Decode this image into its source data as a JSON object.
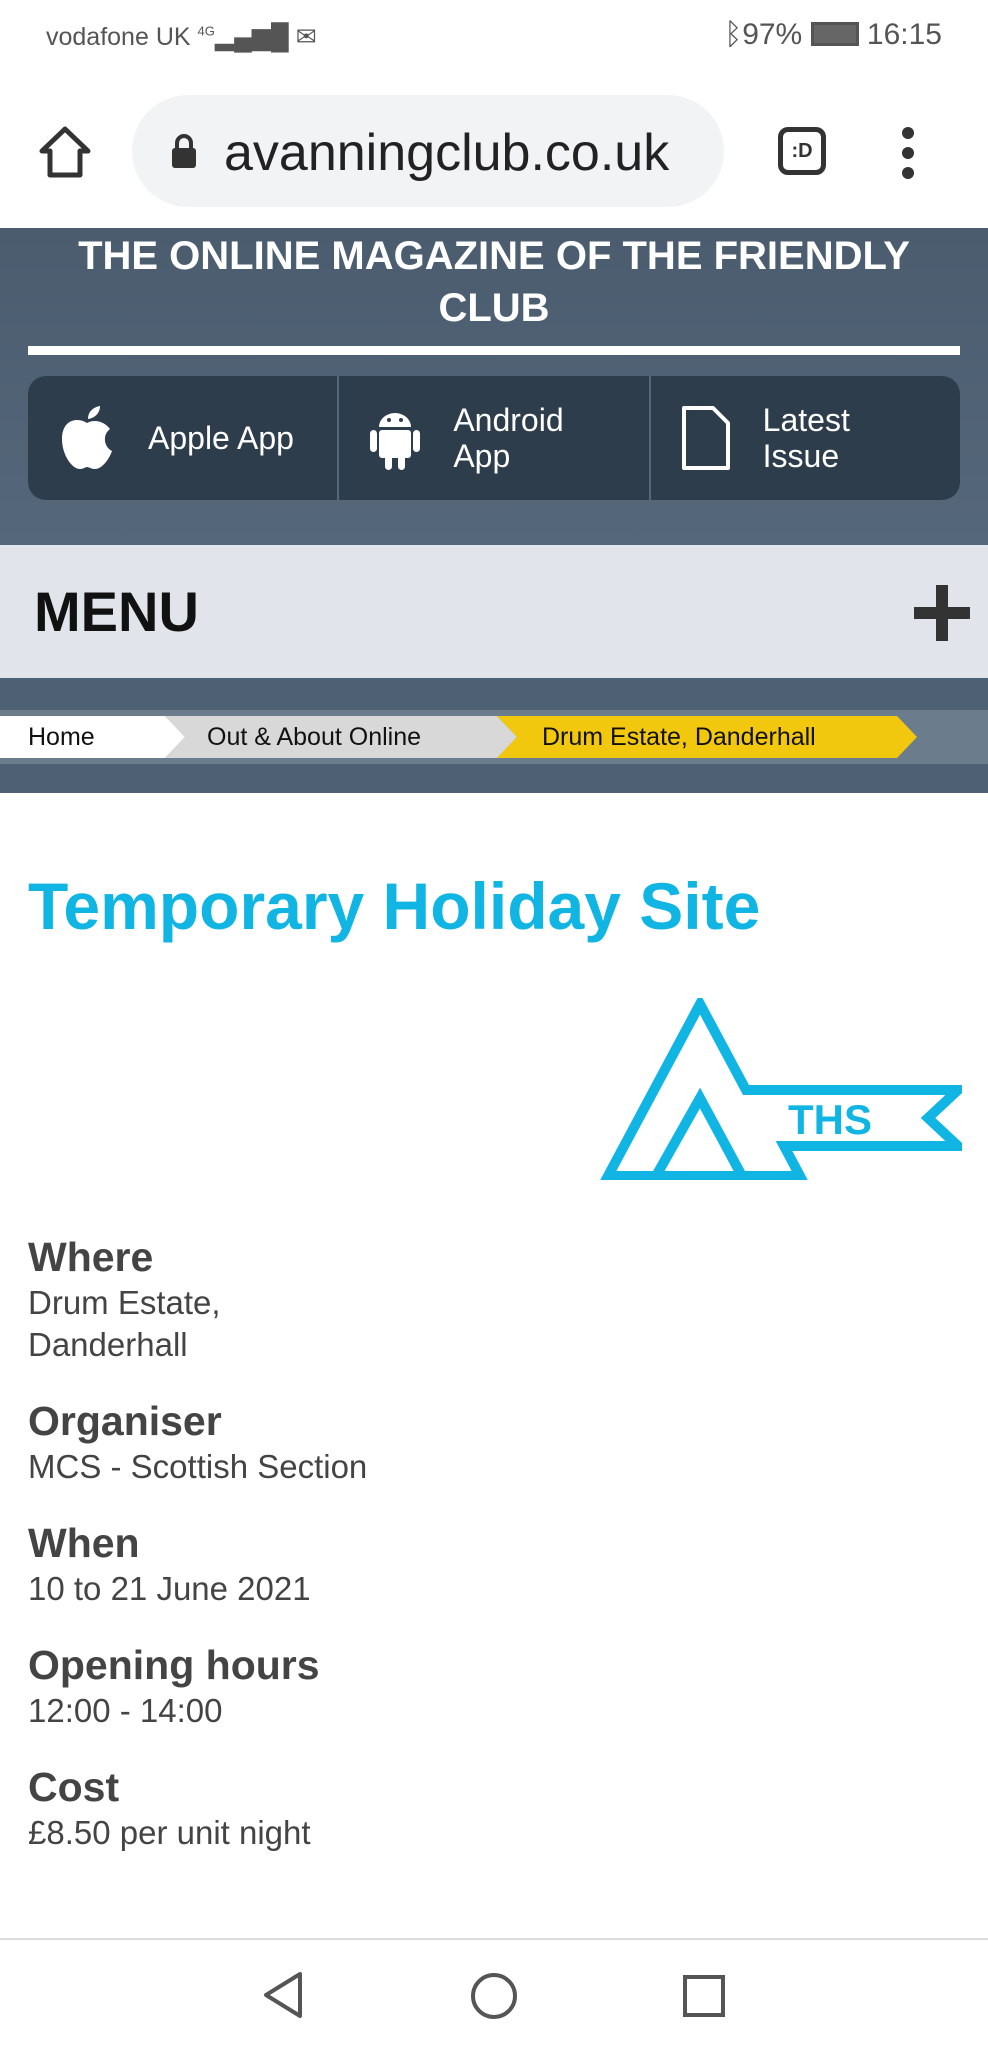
{
  "status_bar": {
    "carrier": "vodafone UK",
    "network": "4G",
    "battery": "97%",
    "time": "16:15"
  },
  "browser": {
    "url": "avanningclub.co.uk",
    "tabs_label": ":D"
  },
  "header": {
    "title": "THE ONLINE MAGAZINE OF THE FRIENDLY CLUB",
    "apps": [
      {
        "label": "Apple App",
        "icon": "apple-icon"
      },
      {
        "label": "Android App",
        "icon": "android-icon"
      },
      {
        "label": "Latest Issue",
        "icon": "document-icon"
      }
    ]
  },
  "menu": {
    "label": "MENU"
  },
  "breadcrumb": [
    {
      "label": "Home"
    },
    {
      "label": "Out & About Online"
    },
    {
      "label": "Drum Estate, Danderhall"
    }
  ],
  "page": {
    "title": "Temporary Holiday Site",
    "logo_text": "THS",
    "details": [
      {
        "label": "Where",
        "value": "Drum Estate,\nDanderhall"
      },
      {
        "label": "Organiser",
        "value": "MCS - Scottish Section"
      },
      {
        "label": "When",
        "value": "10 to 21 June 2021"
      },
      {
        "label": "Opening hours",
        "value": "12:00 - 14:00"
      },
      {
        "label": "Cost",
        "value": "£8.50 per unit night"
      }
    ]
  },
  "colors": {
    "accent": "#11b5e4",
    "breadcrumb_active": "#f2c80f",
    "header": "#4a5c6e"
  }
}
